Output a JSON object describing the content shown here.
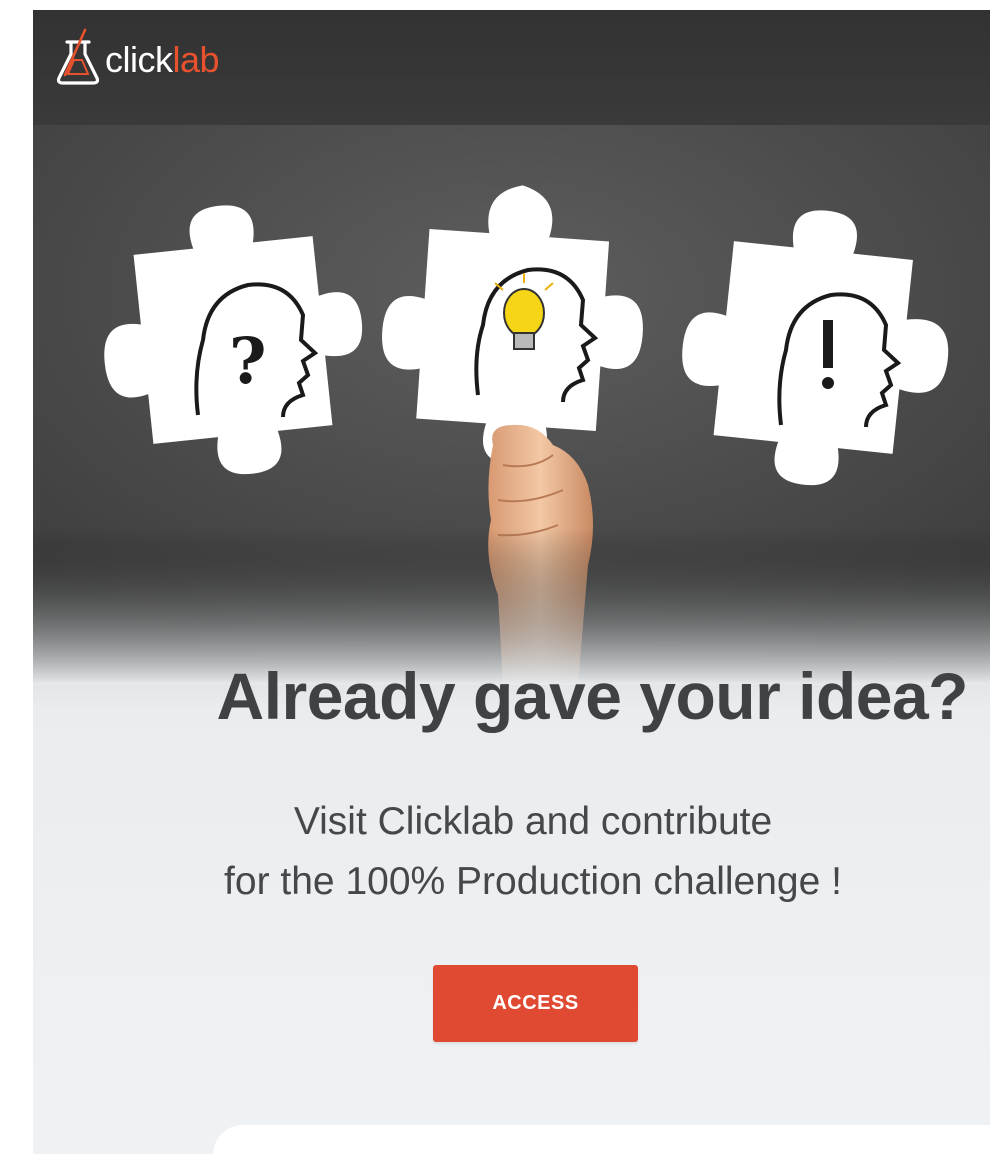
{
  "brand": {
    "logo_click": "click",
    "logo_lab": "lab",
    "accent_color": "#e8512e"
  },
  "hero": {
    "image_icons": [
      "question-mark-head-icon",
      "lightbulb-head-icon",
      "exclamation-head-icon",
      "hand-icon"
    ]
  },
  "main": {
    "headline": "Already gave your idea?",
    "sub_line1": "Visit Clicklab and contribute",
    "sub_line2": "for the 100% Production challenge !",
    "access_label": "ACCESS",
    "button_color": "#e04a33"
  }
}
